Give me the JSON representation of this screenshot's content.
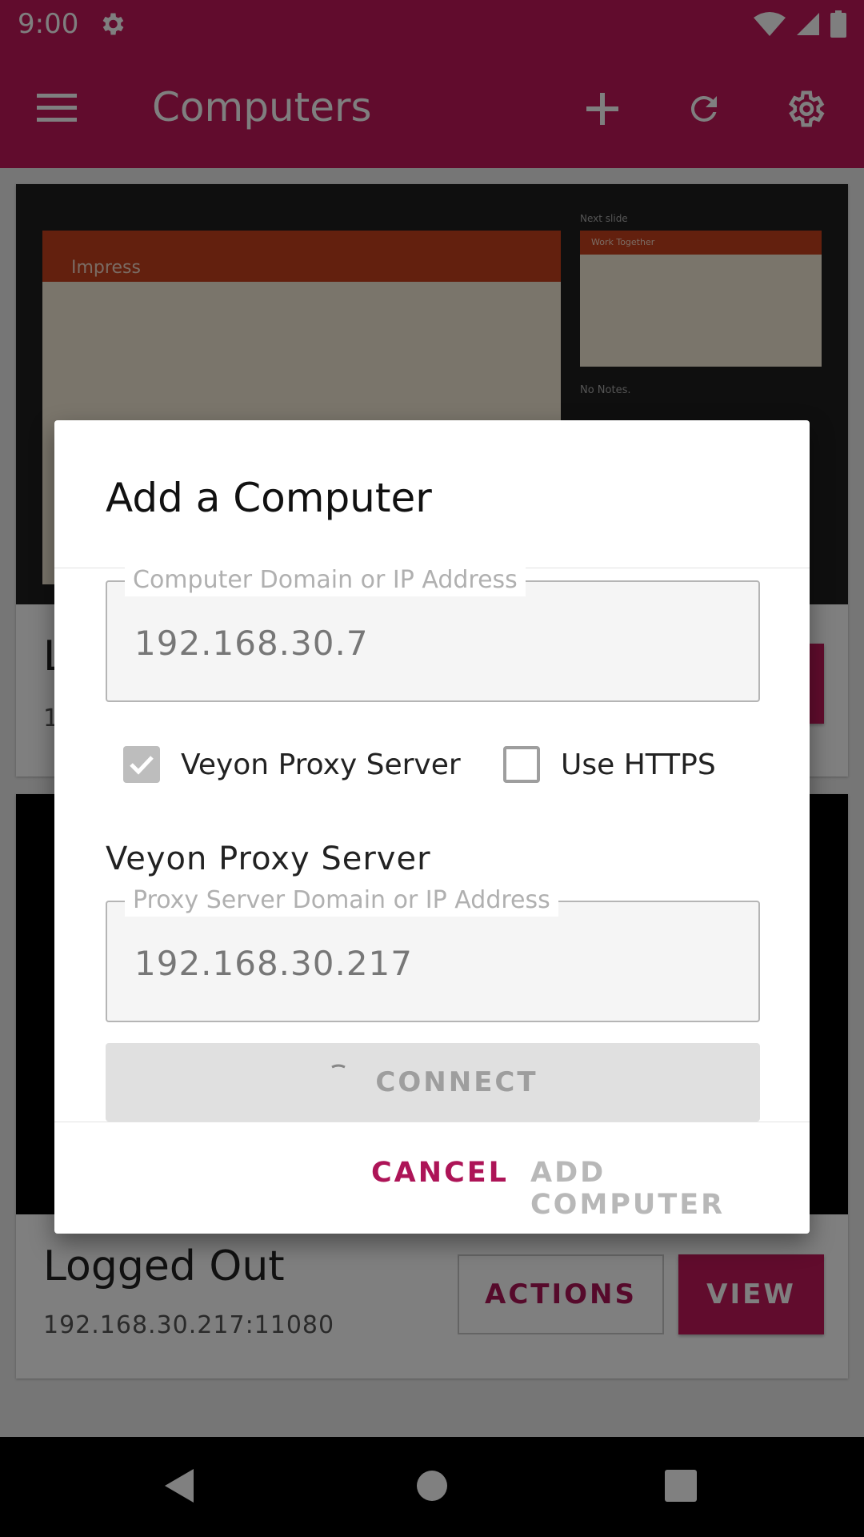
{
  "status_bar": {
    "time": "9:00"
  },
  "app_bar": {
    "title": "Computers"
  },
  "cards": [
    {
      "title": "L",
      "subtitle": "1",
      "thumb_title": "Impress",
      "thumb_side_title": "Work Together",
      "thumb_side_note": "No Notes.",
      "thumb_side_label": "Next slide"
    },
    {
      "title": "Logged Out",
      "subtitle": "192.168.30.217:11080",
      "actions_label": "ACTIONS",
      "view_label": "VIEW"
    }
  ],
  "dialog": {
    "title": "Add a Computer",
    "computer_field": {
      "label": "Computer Domain or IP Address",
      "value": "192.168.30.7"
    },
    "proxy_checkbox": {
      "label": "Veyon Proxy Server",
      "checked": true
    },
    "https_checkbox": {
      "label": "Use HTTPS",
      "checked": false
    },
    "proxy_section_title": "Veyon Proxy Server",
    "proxy_field": {
      "label": "Proxy Server Domain or IP Address",
      "value": "192.168.30.217"
    },
    "connect_label": "CONNECT",
    "cancel_label": "CANCEL",
    "add_label": "ADD COMPUTER"
  },
  "colors": {
    "primary": "#c2185b",
    "accent_text": "#ad1457",
    "disabled": "#9e9e9e"
  }
}
